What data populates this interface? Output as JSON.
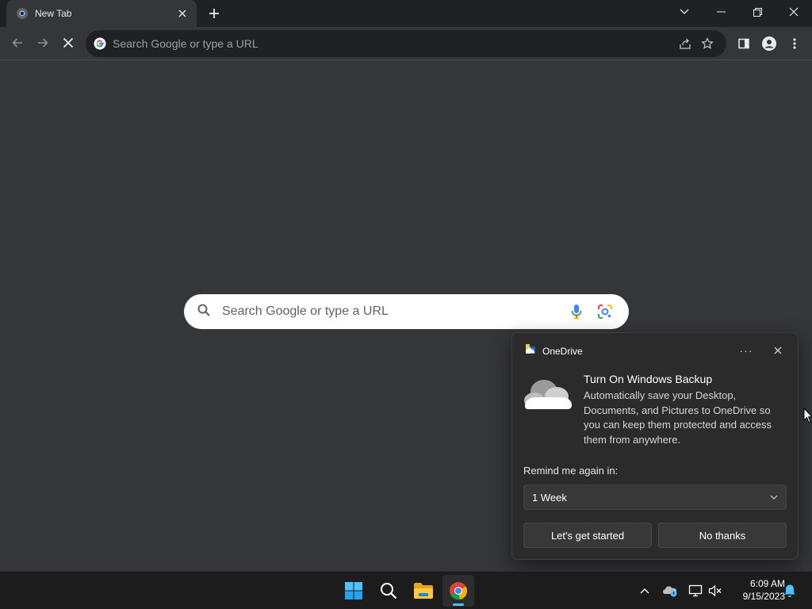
{
  "browser": {
    "tab": {
      "title": "New Tab"
    },
    "omnibox": {
      "placeholder": "Search Google or type a URL"
    }
  },
  "ntp": {
    "search_placeholder": "Search Google or type a URL"
  },
  "toast": {
    "app_name": "OneDrive",
    "more_label": "···",
    "title": "Turn On Windows Backup",
    "body": "Automatically save your Desktop, Documents, and Pictures to OneDrive so you can keep them protected and access them from anywhere.",
    "remind_label": "Remind me again in:",
    "remind_value": "1 Week",
    "primary_button": "Let's get started",
    "secondary_button": "No thanks"
  },
  "taskbar": {
    "time": "6:09 AM",
    "date": "9/15/2023"
  },
  "colors": {
    "chrome_bg": "#35363a",
    "tabstrip_bg": "#202124",
    "toast_bg": "#2b2b2b",
    "taskbar_bg": "#1c1c1c",
    "accent_blue": "#4cc2ff"
  }
}
